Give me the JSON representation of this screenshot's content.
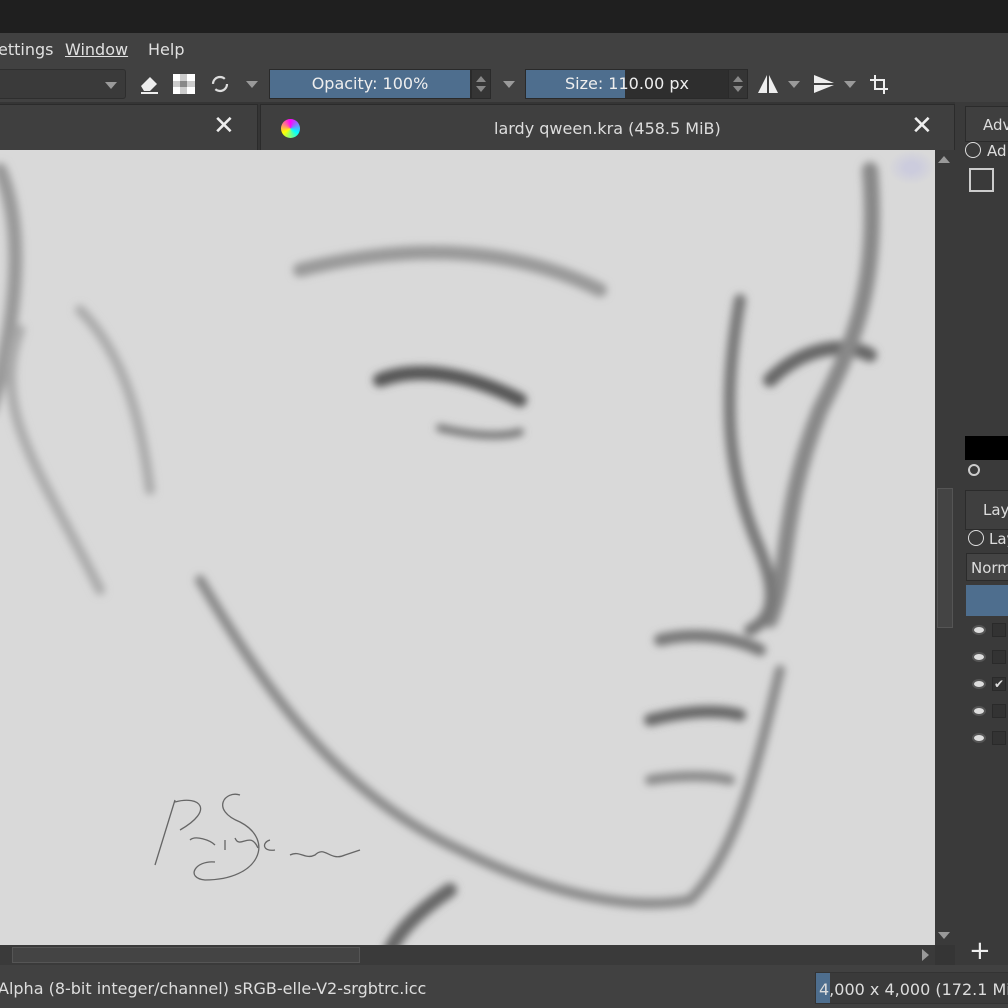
{
  "menu": {
    "items": [
      "ettings",
      "Window",
      "Help"
    ]
  },
  "toolbar": {
    "opacity_label": "Opacity: 100%",
    "opacity_value": 100,
    "size_label": "Size: 110.00 px",
    "size_fill_fraction": 0.49
  },
  "tabs": [
    {
      "title": "",
      "close": "✕"
    },
    {
      "title": "lardy qween.kra (458.5 MiB)",
      "close": "✕"
    }
  ],
  "right_panel": {
    "advanced_tab": "Adv",
    "advanced_lock_label": "Ad",
    "layers_tab": "Lay",
    "layers_lock_label": "Lay",
    "blend_mode": "Norm",
    "add_button": "+",
    "layer_checks": [
      false,
      false,
      true,
      false,
      false
    ]
  },
  "canvas": {
    "signature": "Prince Sketch"
  },
  "status": {
    "color_info": "Alpha (8-bit integer/channel)  sRGB-elle-V2-srgbtrc.icc",
    "image_size": "4,000 x 4,000 (172.1 MiB"
  },
  "colors": {
    "accent": "#4e6e8e",
    "canvas": "#d9d9d9"
  }
}
